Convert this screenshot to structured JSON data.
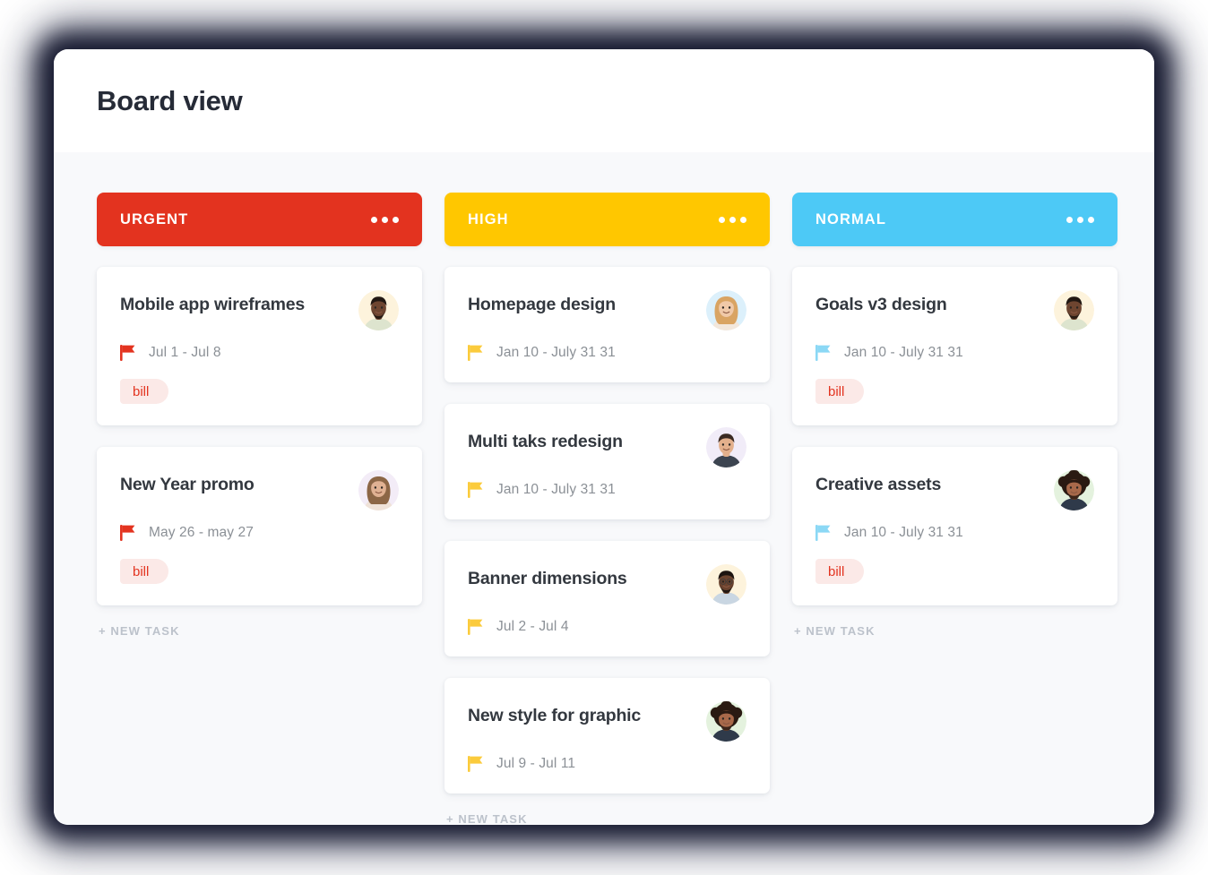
{
  "header": {
    "title": "Board view"
  },
  "new_task_label": "+ NEW TASK",
  "colors": {
    "urgent": "#E3331F",
    "high": "#FFC700",
    "normal": "#4DC9F6",
    "page_bg": "#FFFFFF",
    "board_bg": "#F8F9FB",
    "card_bg": "#FFFFFF",
    "title_text": "#262B37",
    "card_title_text": "#33383F",
    "date_text": "#8B9096",
    "new_task_text": "#BCC2CB",
    "tag_bg": "#FBE9E7",
    "tag_text": "#E3331F",
    "shadow": "#12152B"
  },
  "columns": [
    {
      "id": "urgent",
      "title": "URGENT",
      "accent": "#E3331F",
      "flag_color": "#E3331F",
      "menu_icon": "three-dots-icon",
      "menu_label": "Column options",
      "cards": [
        {
          "title": "Mobile app wireframes",
          "date": "Jul 1 - Jul 8",
          "flag_icon": "flag-icon",
          "tag": "bill",
          "avatar": "avatar-bearded-man",
          "avatar_bg": "#FDF3DC",
          "avatar_skin": "#6E4530",
          "avatar_hair": "#211712",
          "avatar_shirt": "#DDE4CE"
        },
        {
          "title": "New Year promo",
          "date": "May 26 - may 27",
          "flag_icon": "flag-icon",
          "tag": "bill",
          "avatar": "avatar-smiling-woman",
          "avatar_bg": "#F3ECF7",
          "avatar_skin": "#E0B193",
          "avatar_hair": "#8C6646",
          "avatar_shirt": "#EFE2D8"
        }
      ]
    },
    {
      "id": "high",
      "title": "HIGH",
      "accent": "#FFC700",
      "flag_color": "#FBCB3C",
      "menu_icon": "three-dots-icon",
      "menu_label": "Column options",
      "cards": [
        {
          "title": "Homepage design",
          "date": "Jan 10 - July 31 31",
          "flag_icon": "flag-icon",
          "tag": null,
          "avatar": "avatar-blonde-woman",
          "avatar_bg": "#DCF0FB",
          "avatar_skin": "#F0C9A8",
          "avatar_hair": "#D9A463",
          "avatar_shirt": "#F2E7DC"
        },
        {
          "title": "Multi taks redesign",
          "date": "Jan 10 - July 31 31",
          "flag_icon": "flag-icon",
          "tag": null,
          "avatar": "avatar-young-man",
          "avatar_bg": "#F1ECF8",
          "avatar_skin": "#E3B08C",
          "avatar_hair": "#3A2A22",
          "avatar_shirt": "#3C4450"
        },
        {
          "title": "Banner dimensions",
          "date": "Jul 2 - Jul 4",
          "flag_icon": "flag-icon",
          "tag": null,
          "avatar": "avatar-man-glasses",
          "avatar_bg": "#FDF3DC",
          "avatar_skin": "#6B432E",
          "avatar_hair": "#1C1410",
          "avatar_shirt": "#C9D6E2"
        },
        {
          "title": "New style for graphic",
          "date": "Jul 9 - Jul 11",
          "flag_icon": "flag-icon",
          "tag": null,
          "avatar": "avatar-afro-man",
          "avatar_bg": "#E4F2DE",
          "avatar_skin": "#A8694A",
          "avatar_hair": "#2A1A12",
          "avatar_shirt": "#2F3A4A"
        }
      ]
    },
    {
      "id": "normal",
      "title": "NORMAL",
      "accent": "#4DC9F6",
      "flag_color": "#8BD8F5",
      "menu_icon": "three-dots-icon",
      "menu_label": "Column options",
      "cards": [
        {
          "title": "Goals v3 design",
          "date": "Jan 10 - July 31 31",
          "flag_icon": "flag-icon",
          "tag": "bill",
          "avatar": "avatar-bearded-man",
          "avatar_bg": "#FDF3DC",
          "avatar_skin": "#6E4530",
          "avatar_hair": "#211712",
          "avatar_shirt": "#DDE4CE"
        },
        {
          "title": "Creative assets",
          "date": "Jan 10 - July 31 31",
          "flag_icon": "flag-icon",
          "tag": "bill",
          "avatar": "avatar-afro-man",
          "avatar_bg": "#E4F2DE",
          "avatar_skin": "#A8694A",
          "avatar_hair": "#2A1A12",
          "avatar_shirt": "#2F3A4A"
        }
      ]
    }
  ]
}
